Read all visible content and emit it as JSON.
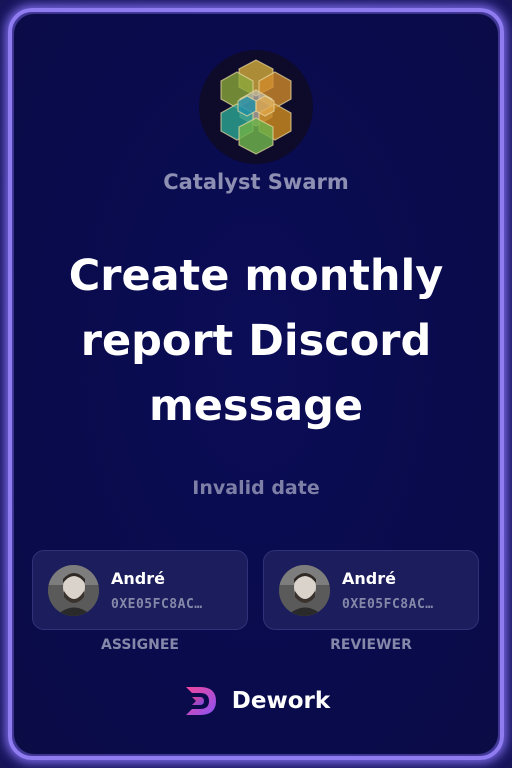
{
  "organization": {
    "name": "Catalyst Swarm",
    "logo_icon": "hexagon-cube-logo-icon"
  },
  "task": {
    "title": "Create monthly report Discord message",
    "date": "Invalid date"
  },
  "assignee": {
    "name": "André",
    "address": "0XE05FC8AC…",
    "role": "ASSIGNEE",
    "avatar_icon": "user-avatar"
  },
  "reviewer": {
    "name": "André",
    "address": "0XE05FC8AC…",
    "role": "REVIEWER",
    "avatar_icon": "user-avatar"
  },
  "brand": {
    "name": "Dework",
    "icon": "dework-logo-icon"
  },
  "colors": {
    "frame_glow": "#8f7cf0",
    "card_background": "#0a0b4c",
    "person_card_background": "#1b1d5c",
    "muted_text": "#8688aa",
    "brand_gradient_start": "#f2469b",
    "brand_gradient_end": "#8a53f5"
  }
}
